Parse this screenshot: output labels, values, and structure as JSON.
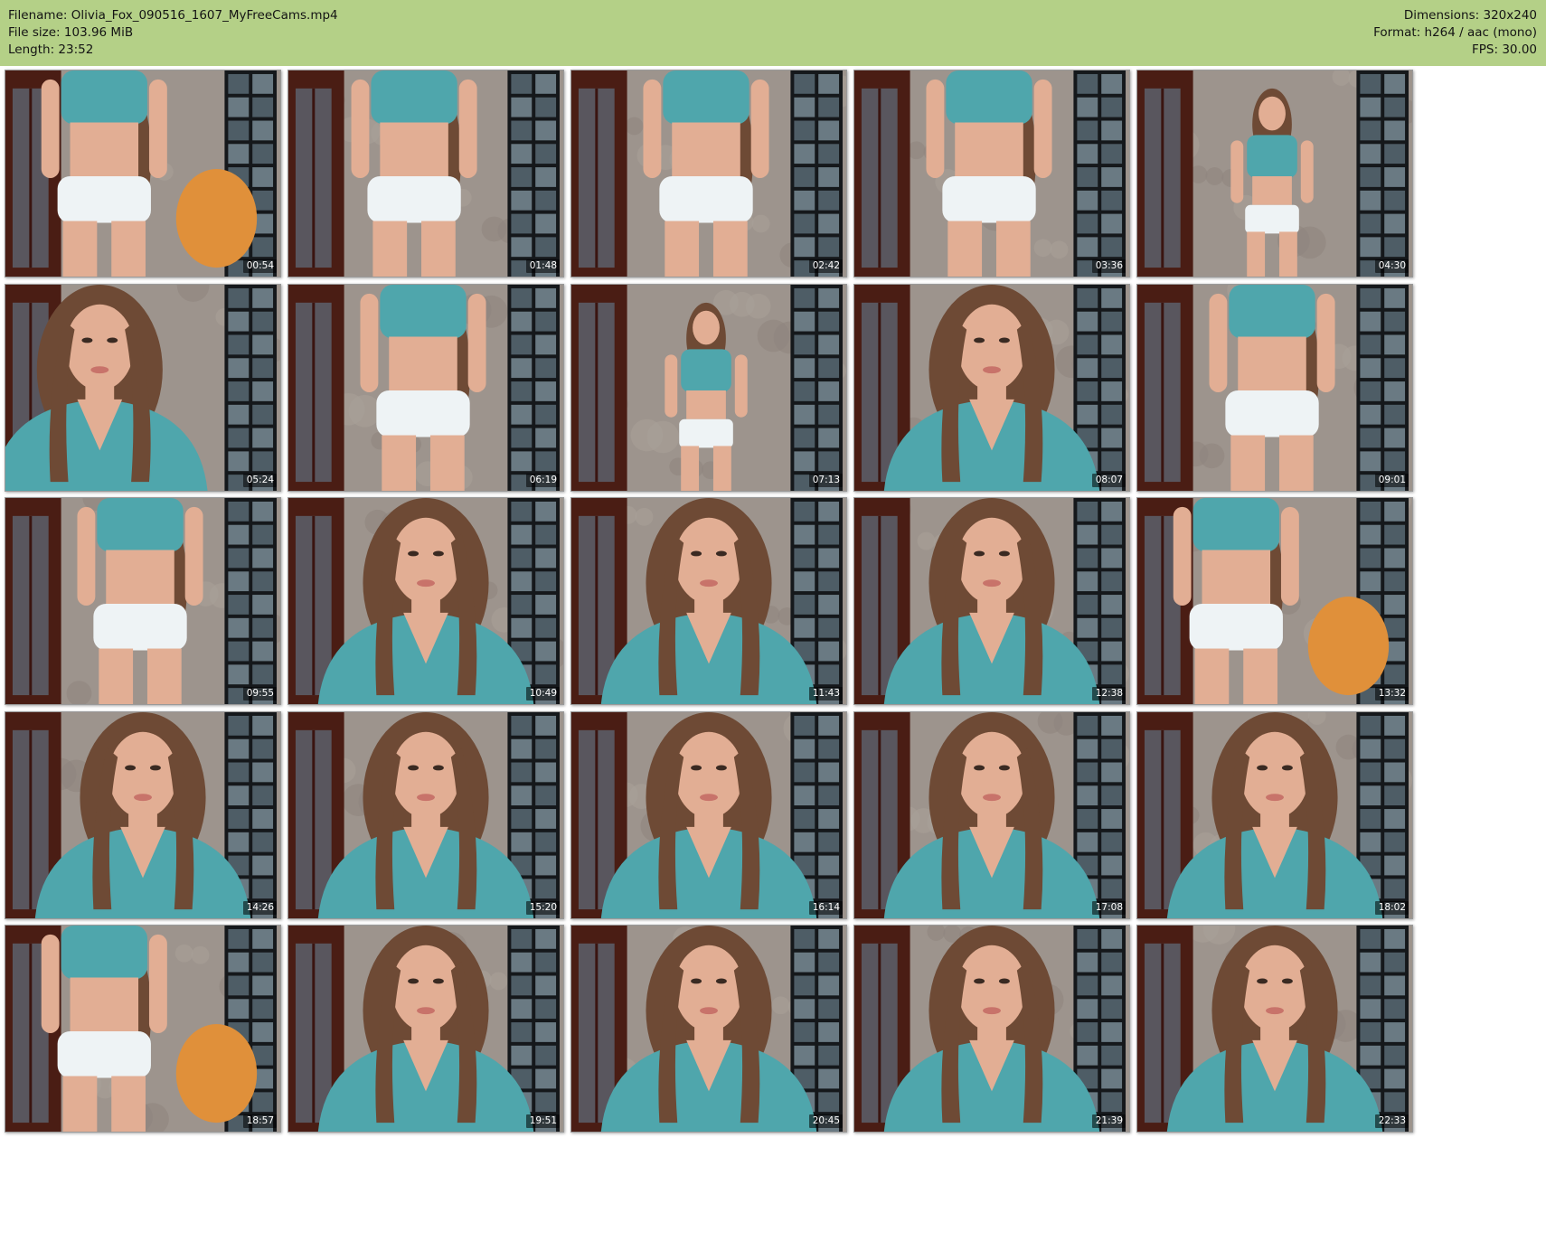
{
  "header": {
    "filename_label": "Filename: Olivia_Fox_090516_1607_MyFreeCams.mp4",
    "filesize_label": "File size: 103.96 MiB",
    "length_label": "Length: 23:52",
    "dimensions_label": "Dimensions: 320x240",
    "format_label": "Format: h264 / aac (mono)",
    "fps_label": "FPS: 30.00"
  },
  "colors": {
    "header_background": "#b4d087",
    "page_background": "#ffffff",
    "timestamp_text": "#ffffff"
  },
  "grid": {
    "columns": 5,
    "rows": 5
  },
  "thumbnails": [
    {
      "timestamp": "00:54",
      "scene": "body-left"
    },
    {
      "timestamp": "01:48",
      "scene": "body-back"
    },
    {
      "timestamp": "02:42",
      "scene": "body-center"
    },
    {
      "timestamp": "03:36",
      "scene": "body-close"
    },
    {
      "timestamp": "04:30",
      "scene": "full-far"
    },
    {
      "timestamp": "05:24",
      "scene": "face-left"
    },
    {
      "timestamp": "06:19",
      "scene": "body-center"
    },
    {
      "timestamp": "07:13",
      "scene": "full-far"
    },
    {
      "timestamp": "08:07",
      "scene": "face-center"
    },
    {
      "timestamp": "09:01",
      "scene": "body-center"
    },
    {
      "timestamp": "09:55",
      "scene": "body-close"
    },
    {
      "timestamp": "10:49",
      "scene": "face-center"
    },
    {
      "timestamp": "11:43",
      "scene": "face-center"
    },
    {
      "timestamp": "12:38",
      "scene": "face-center"
    },
    {
      "timestamp": "13:32",
      "scene": "body-left"
    },
    {
      "timestamp": "14:26",
      "scene": "face-center"
    },
    {
      "timestamp": "15:20",
      "scene": "face-center"
    },
    {
      "timestamp": "16:14",
      "scene": "face-center"
    },
    {
      "timestamp": "17:08",
      "scene": "face-center"
    },
    {
      "timestamp": "18:02",
      "scene": "face-center"
    },
    {
      "timestamp": "18:57",
      "scene": "body-left"
    },
    {
      "timestamp": "19:51",
      "scene": "face-center"
    },
    {
      "timestamp": "20:45",
      "scene": "face-center"
    },
    {
      "timestamp": "21:39",
      "scene": "face-center"
    },
    {
      "timestamp": "22:33",
      "scene": "face-center"
    }
  ]
}
